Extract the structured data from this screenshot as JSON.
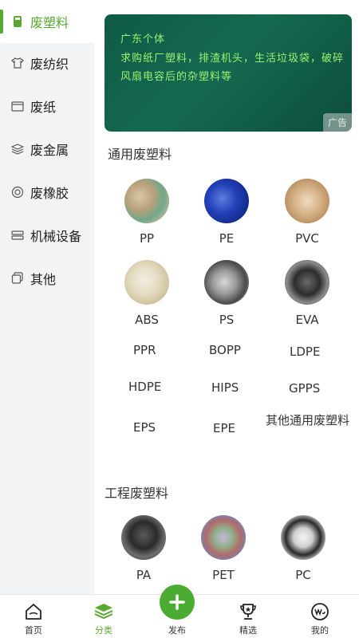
{
  "sidebar": {
    "items": [
      {
        "label": "废塑料",
        "icon": "cup-icon",
        "active": true
      },
      {
        "label": "废纺织",
        "icon": "tshirt-icon"
      },
      {
        "label": "废纸",
        "icon": "box-icon"
      },
      {
        "label": "废金属",
        "icon": "layers-icon"
      },
      {
        "label": "废橡胶",
        "icon": "tire-icon"
      },
      {
        "label": "机械设备",
        "icon": "machine-icon"
      },
      {
        "label": "其他",
        "icon": "copy-icon"
      }
    ]
  },
  "ad": {
    "line1": "广东个体",
    "line2": "求购纸厂塑料，排渣机头，生活垃圾袋，破碎风扇电容后的杂塑料等",
    "tag": "广告"
  },
  "sections": {
    "general": {
      "title": "通用废塑料",
      "image_items": [
        "PP",
        "PE",
        "PVC",
        "ABS",
        "PS",
        "EVA"
      ],
      "text_items": [
        "PPR",
        "BOPP",
        "LDPE",
        "HDPE",
        "HIPS",
        "GPPS",
        "EPS",
        "EPE",
        "其他通用废塑料"
      ]
    },
    "engineering": {
      "title": "工程废塑料",
      "image_items": [
        "PA",
        "PET",
        "PC"
      ]
    }
  },
  "tabbar": {
    "home": "首页",
    "category": "分类",
    "publish": "发布",
    "featured": "精选",
    "mine": "我的"
  },
  "colors": {
    "accent": "#5aa832",
    "ad_text": "#9ff070",
    "ad_bg": "#0f5a45"
  }
}
